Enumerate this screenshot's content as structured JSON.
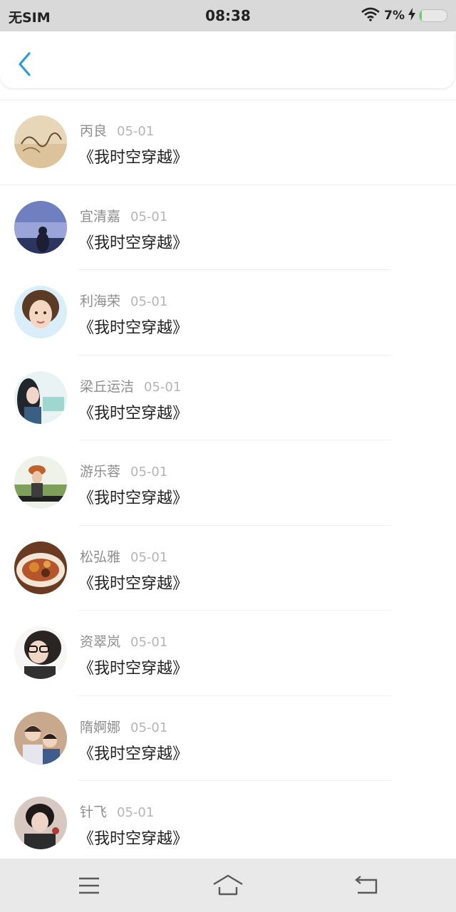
{
  "status_bar": {
    "carrier": "无SIM",
    "time": "08:38",
    "battery_text": "7%",
    "battery_level": 0.07,
    "icons": [
      "wifi-icon",
      "charging-bolt-icon",
      "battery-icon"
    ]
  },
  "header": {
    "back_icon": "chevron-left-icon",
    "accent_color": "#2e9bd6"
  },
  "list": {
    "items": [
      {
        "name": "丙良",
        "date": "05-01",
        "title": "《我时空穿越》"
      },
      {
        "name": "宜清嘉",
        "date": "05-01",
        "title": "《我时空穿越》"
      },
      {
        "name": "利海荣",
        "date": "05-01",
        "title": "《我时空穿越》"
      },
      {
        "name": "梁丘运洁",
        "date": "05-01",
        "title": "《我时空穿越》"
      },
      {
        "name": "游乐蓉",
        "date": "05-01",
        "title": "《我时空穿越》"
      },
      {
        "name": "松弘雅",
        "date": "05-01",
        "title": "《我时空穿越》"
      },
      {
        "name": "资翠岚",
        "date": "05-01",
        "title": "《我时空穿越》"
      },
      {
        "name": "隋婀娜",
        "date": "05-01",
        "title": "《我时空穿越》"
      },
      {
        "name": "针飞",
        "date": "05-01",
        "title": "《我时空穿越》"
      }
    ]
  },
  "nav_bar": {
    "icons": [
      "menu-icon",
      "home-icon",
      "back-icon"
    ]
  }
}
